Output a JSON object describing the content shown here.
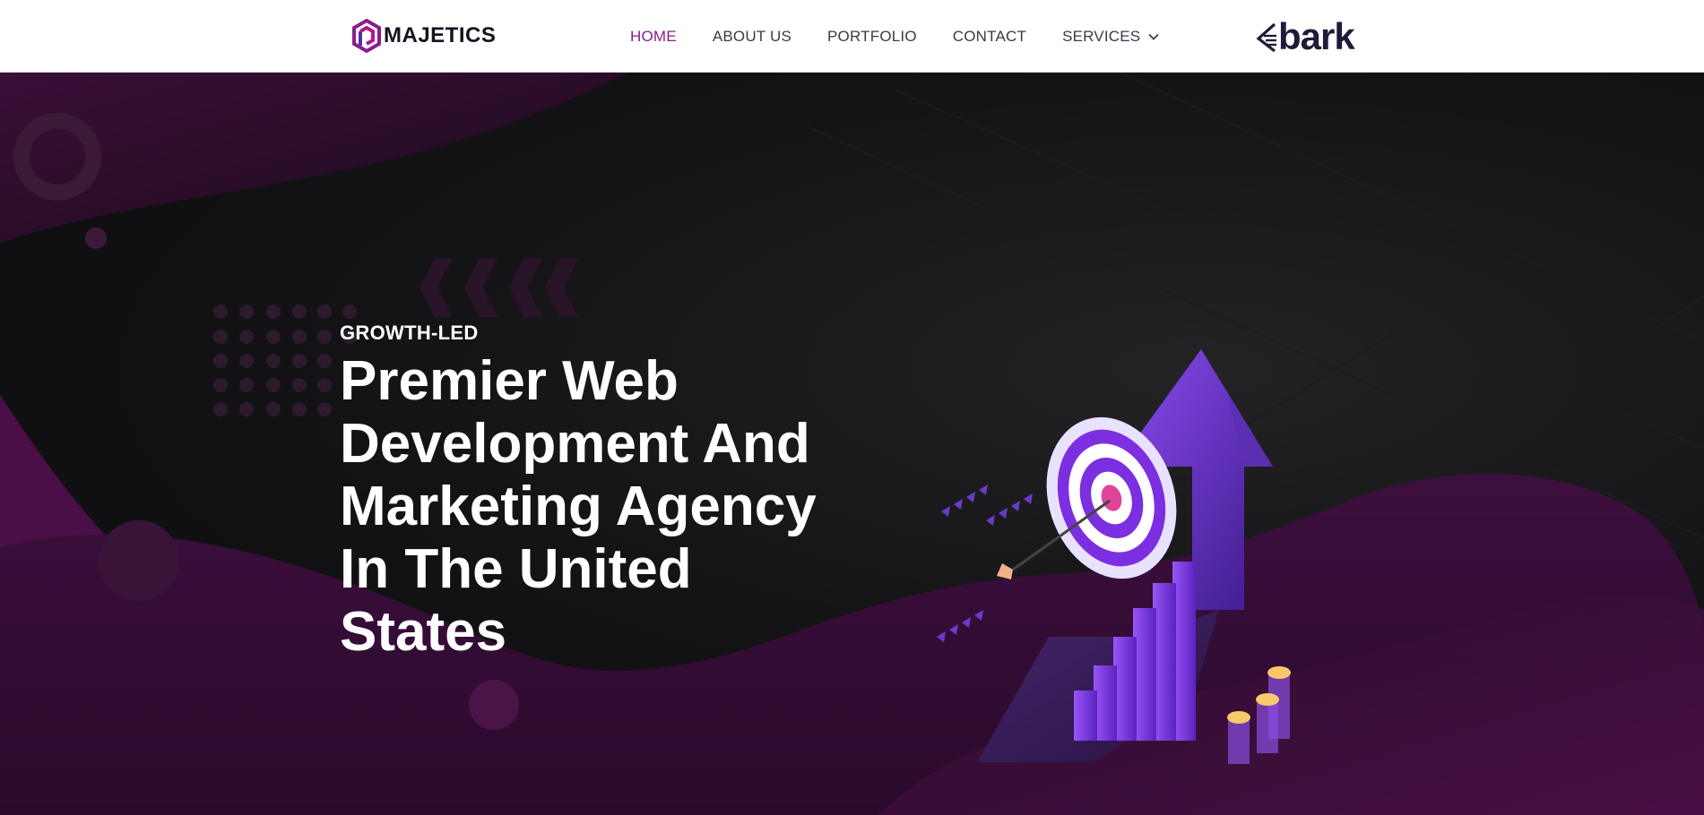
{
  "header": {
    "logo_text": "MAJETICS",
    "nav": [
      {
        "label": "HOME",
        "active": true
      },
      {
        "label": "ABOUT US",
        "active": false
      },
      {
        "label": "PORTFOLIO",
        "active": false
      },
      {
        "label": "CONTACT",
        "active": false
      },
      {
        "label": "SERVICES",
        "active": false
      }
    ],
    "partner_logo_text": "bark"
  },
  "hero": {
    "eyebrow": "GROWTH-LED",
    "headline_lines": [
      "Premier Web",
      "Development And",
      "Marketing Agency",
      "In The United",
      "States"
    ]
  },
  "colors": {
    "accent": "#8a1c8f",
    "nav_text": "#3a3a4a",
    "hero_bg": "#0b0b0d",
    "hero_purple": "#5a1250",
    "illustration_purple": "#7b2fe0"
  },
  "icons": [
    "majetics-logo-icon",
    "chevron-down-icon",
    "bark-logo-icon",
    "target-growth-illustration"
  ]
}
